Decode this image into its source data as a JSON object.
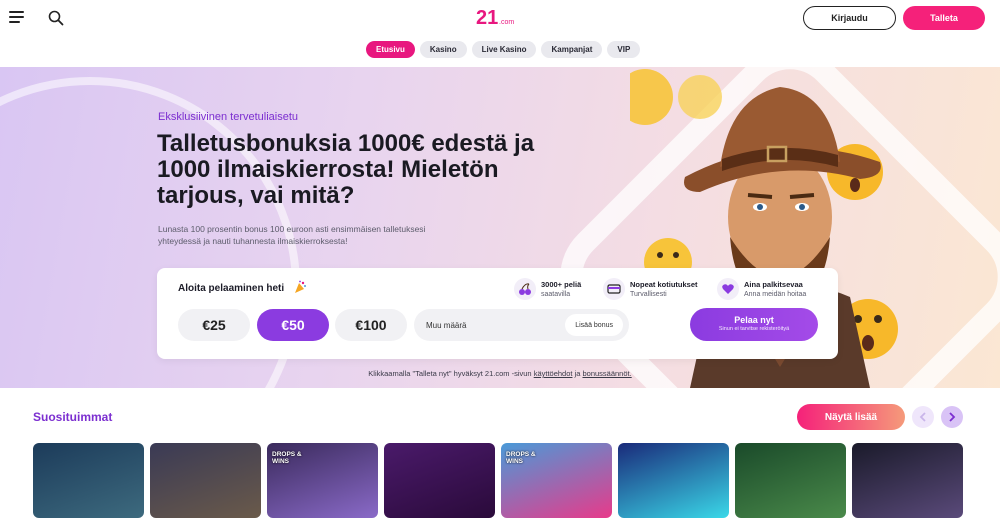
{
  "header": {
    "logo_text": "21.com",
    "login_label": "Kirjaudu",
    "deposit_label": "Talleta"
  },
  "nav": {
    "tabs": [
      {
        "label": "Etusivu",
        "active": true
      },
      {
        "label": "Kasino"
      },
      {
        "label": "Live Kasino"
      },
      {
        "label": "Kampanjat"
      },
      {
        "label": "VIP"
      }
    ]
  },
  "hero": {
    "eyebrow": "Eksklusiivinen tervetuliaisetu",
    "title": "Talletusbonuksia 1000€ edestä ja 1000 ilmaiskierrosta! Mieletön tarjous, vai mitä?",
    "subtitle": "Lunasta 100 prosentin bonus 100 euroon asti ensimmäisen talletuksesi yhteydessä ja nauti tuhannesta ilmaiskierroksesta!"
  },
  "card": {
    "heading": "Aloita pelaaminen heti",
    "features": [
      {
        "title": "3000+ peliä",
        "subtitle": "saatavilla",
        "icon": "cherries-icon"
      },
      {
        "title": "Nopeat kotiutukset",
        "subtitle": "Turvallisesti",
        "icon": "card-icon"
      },
      {
        "title": "Aina palkitsevaa",
        "subtitle": "Anna meidän hoitaa",
        "icon": "heart-icon"
      }
    ],
    "amounts": [
      "€25",
      "€50",
      "€100"
    ],
    "selected_amount": "€50",
    "other_amount_placeholder": "Muu määrä",
    "add_bonus_label": "Lisää bonus",
    "play_label": "Pelaa nyt",
    "play_sublabel": "Sinun ei tarvitse rekisteröityä"
  },
  "terms": {
    "prefix": "Klikkaamalla \"Talleta nyt\" hyväksyt 21.com -sivun ",
    "link1": "käyttöehdot",
    "middle": " ja ",
    "link2": "bonussäännöt."
  },
  "popular": {
    "title": "Suosituimmat",
    "show_more_label": "Näytä lisää",
    "badge_text": "DROPS & WINS",
    "games": [
      {
        "name": "game-tile-1",
        "colors": [
          "#1c3b5a",
          "#3d6a7e"
        ]
      },
      {
        "name": "game-tile-2",
        "colors": [
          "#3a3a55",
          "#6a5a4a"
        ]
      },
      {
        "name": "game-tile-3",
        "colors": [
          "#3a2a5c",
          "#8a6ac8"
        ],
        "badge": true
      },
      {
        "name": "game-tile-4",
        "colors": [
          "#4a1a6a",
          "#2a0a3a"
        ]
      },
      {
        "name": "game-tile-5",
        "colors": [
          "#4a9ad8",
          "#e83a8a"
        ],
        "badge": true
      },
      {
        "name": "game-tile-6",
        "colors": [
          "#1a2a7a",
          "#3ad8e8"
        ]
      },
      {
        "name": "game-tile-7",
        "colors": [
          "#1a4a2a",
          "#4a8a4a"
        ]
      },
      {
        "name": "game-tile-8",
        "colors": [
          "#1a1a2a",
          "#5a4a7a"
        ]
      }
    ]
  },
  "colors": {
    "accent_pink": "#f5217a",
    "accent_purple": "#8b3be0",
    "heading_purple": "#7c2fd0"
  }
}
